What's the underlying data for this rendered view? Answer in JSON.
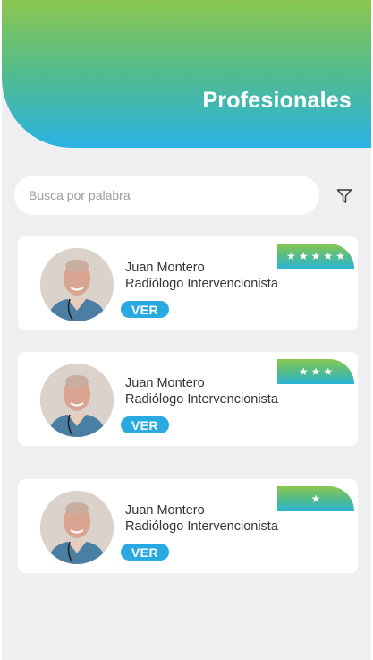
{
  "header": {
    "title": "Profesionales"
  },
  "search": {
    "placeholder": "Busca por palabra",
    "value": ""
  },
  "filter": {
    "icon": "filter-icon"
  },
  "professionals": [
    {
      "name": "Juan Montero",
      "role": "Radiólogo Intervencionista",
      "button_label": "VER",
      "rating": 5
    },
    {
      "name": "Juan Montero",
      "role": "Radiólogo Intervencionista",
      "button_label": "VER",
      "rating": 3
    },
    {
      "name": "Juan Montero",
      "role": "Radiólogo Intervencionista",
      "button_label": "VER",
      "rating": 1
    }
  ],
  "colors": {
    "gradient_top": "#8bc74f",
    "gradient_bottom": "#29b3e3",
    "button": "#29a9e1",
    "background": "#efeff1"
  }
}
